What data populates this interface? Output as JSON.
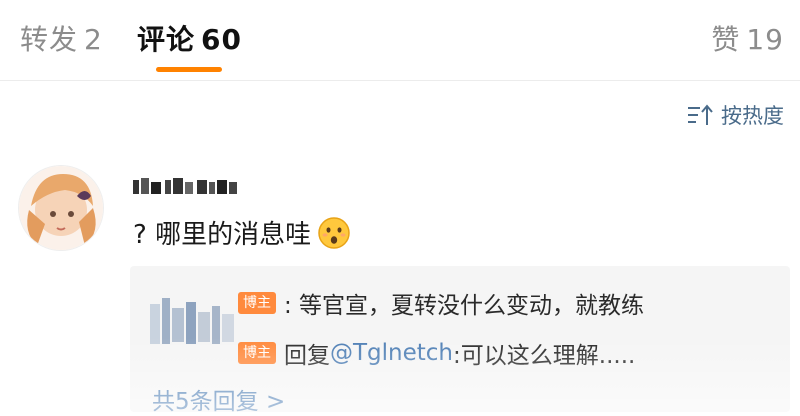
{
  "tabs": [
    {
      "label": "转发",
      "count": "2"
    },
    {
      "label": "评论",
      "count": "60"
    },
    {
      "label": "赞",
      "count": "19"
    }
  ],
  "colors": {
    "accent": "#ff8200",
    "link": "#4f7fb5",
    "badge": "#ff8a3d"
  },
  "sort": {
    "label": "按热度",
    "icon": "sort-icon"
  },
  "comment": {
    "text": "? 哪里的消息哇",
    "emoji": "surprised-face-emoji"
  },
  "replies": [
    {
      "badge": "博主",
      "text": ": 等官宣，夏转没什么变动，就教练"
    },
    {
      "badge": "博主",
      "prefix": "回复",
      "mention": "@Tglnetch",
      "text": ":可以这么理解....."
    }
  ],
  "more_replies": "共5条回复 >"
}
